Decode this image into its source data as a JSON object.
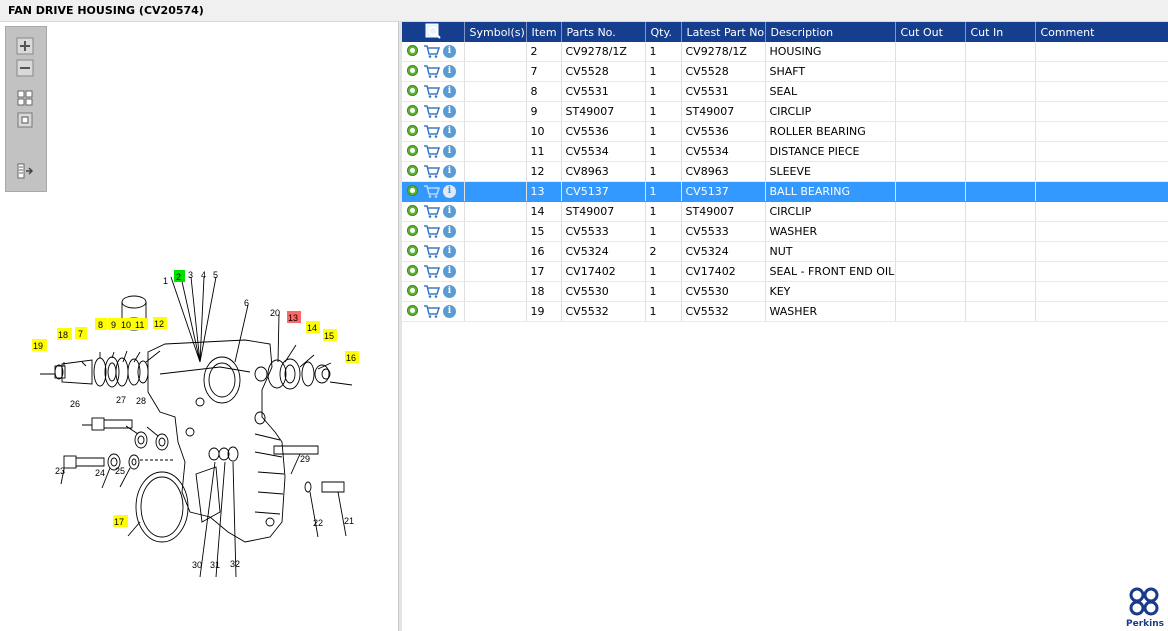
{
  "window": {
    "title": "FAN DRIVE HOUSING (CV20574)"
  },
  "toolbox": {
    "buttons": [
      "zoom-in",
      "zoom-out",
      "fit-page",
      "actual-size",
      "toggle-panel"
    ]
  },
  "diagram": {
    "callouts": [
      "1",
      "2",
      "3",
      "4",
      "5",
      "6",
      "7",
      "8",
      "9",
      "10",
      "11",
      "12",
      "13",
      "14",
      "15",
      "16",
      "17",
      "18",
      "19",
      "20",
      "21",
      "22",
      "23",
      "24",
      "25",
      "26",
      "27",
      "28",
      "29",
      "30",
      "31",
      "32"
    ],
    "highlight_yellow": [
      "7",
      "8",
      "9",
      "10",
      "11",
      "12",
      "14",
      "15",
      "16",
      "17",
      "18",
      "19"
    ],
    "highlight_green": [
      "2"
    ],
    "highlight_red": [
      "13"
    ]
  },
  "table": {
    "headers": [
      "Symbol(s)",
      "Item",
      "Parts No.",
      "Qty.",
      "Latest Part No.",
      "Description",
      "Cut Out",
      "Cut In",
      "Comment"
    ],
    "rows": [
      {
        "item": "2",
        "part": "CV9278/1Z",
        "qty": "1",
        "latest": "CV9278/1Z",
        "desc": "HOUSING"
      },
      {
        "item": "7",
        "part": "CV5528",
        "qty": "1",
        "latest": "CV5528",
        "desc": "SHAFT"
      },
      {
        "item": "8",
        "part": "CV5531",
        "qty": "1",
        "latest": "CV5531",
        "desc": "SEAL"
      },
      {
        "item": "9",
        "part": "ST49007",
        "qty": "1",
        "latest": "ST49007",
        "desc": "CIRCLIP"
      },
      {
        "item": "10",
        "part": "CV5536",
        "qty": "1",
        "latest": "CV5536",
        "desc": "ROLLER BEARING"
      },
      {
        "item": "11",
        "part": "CV5534",
        "qty": "1",
        "latest": "CV5534",
        "desc": "DISTANCE PIECE"
      },
      {
        "item": "12",
        "part": "CV8963",
        "qty": "1",
        "latest": "CV8963",
        "desc": "SLEEVE"
      },
      {
        "item": "13",
        "part": "CV5137",
        "qty": "1",
        "latest": "CV5137",
        "desc": "BALL BEARING",
        "selected": true
      },
      {
        "item": "14",
        "part": "ST49007",
        "qty": "1",
        "latest": "ST49007",
        "desc": "CIRCLIP"
      },
      {
        "item": "15",
        "part": "CV5533",
        "qty": "1",
        "latest": "CV5533",
        "desc": "WASHER"
      },
      {
        "item": "16",
        "part": "CV5324",
        "qty": "2",
        "latest": "CV5324",
        "desc": "NUT"
      },
      {
        "item": "17",
        "part": "CV17402",
        "qty": "1",
        "latest": "CV17402",
        "desc": "SEAL - FRONT END OIL"
      },
      {
        "item": "18",
        "part": "CV5530",
        "qty": "1",
        "latest": "CV5530",
        "desc": "KEY"
      },
      {
        "item": "19",
        "part": "CV5532",
        "qty": "1",
        "latest": "CV5532",
        "desc": "WASHER"
      }
    ]
  },
  "brand": {
    "name": "Perkins",
    "color": "#1b3a8a"
  },
  "colors": {
    "header": "#153e8e",
    "selected": "#3399ff",
    "gear": "#5cb531",
    "highlight": "#ffff00"
  }
}
